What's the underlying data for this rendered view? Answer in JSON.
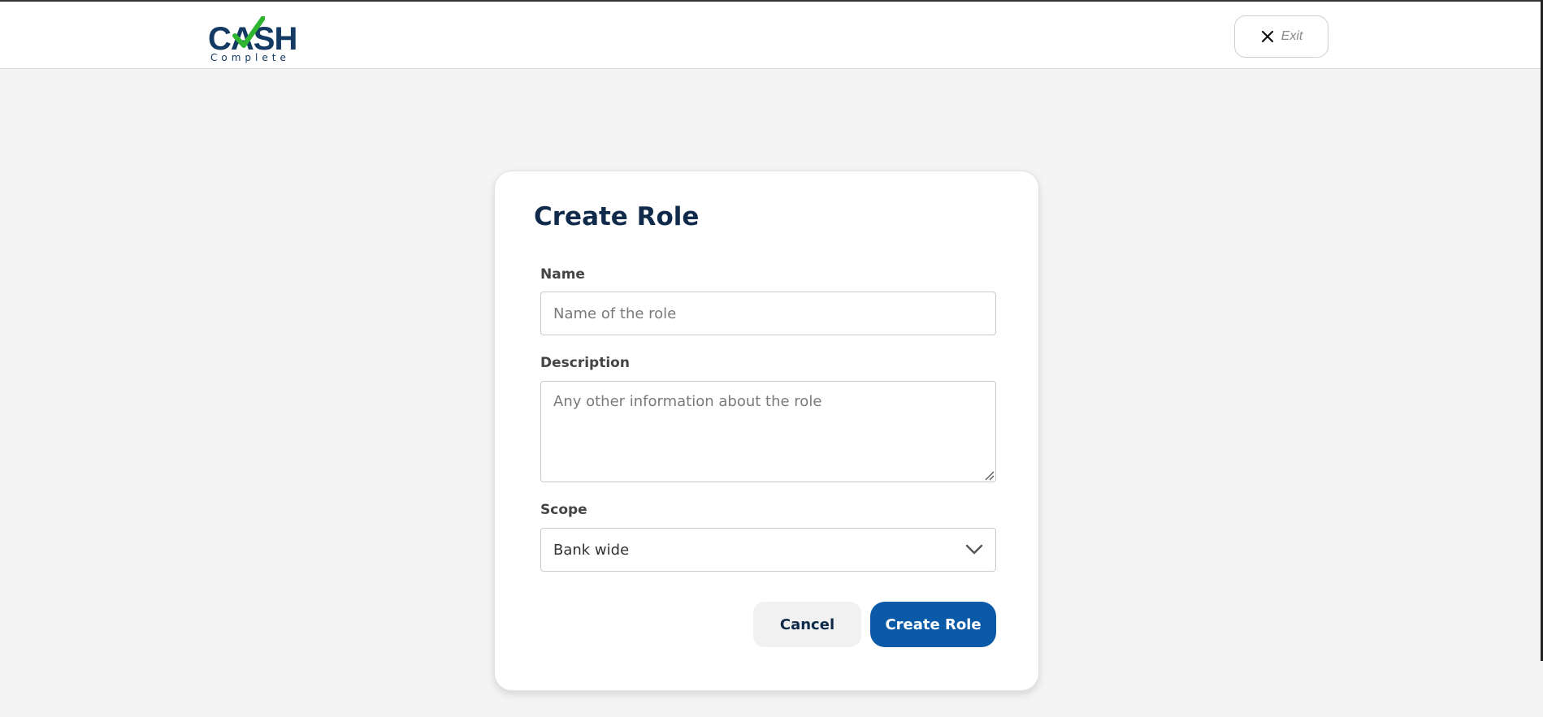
{
  "header": {
    "logo": {
      "word": "CASH",
      "sub": "Complete",
      "brand_color": "#123a62",
      "check_color": "#2fb52f"
    },
    "exit_label": "Exit",
    "exit_icon": "close-icon"
  },
  "form": {
    "title": "Create Role",
    "name": {
      "label": "Name",
      "placeholder": "Name of the role",
      "value": ""
    },
    "description": {
      "label": "Description",
      "placeholder": "Any other information about the role",
      "value": ""
    },
    "scope": {
      "label": "Scope",
      "selected": "Bank wide",
      "icon": "chevron-down-icon"
    },
    "cancel_label": "Cancel",
    "submit_label": "Create Role",
    "accent_color": "#0b5aa8"
  }
}
